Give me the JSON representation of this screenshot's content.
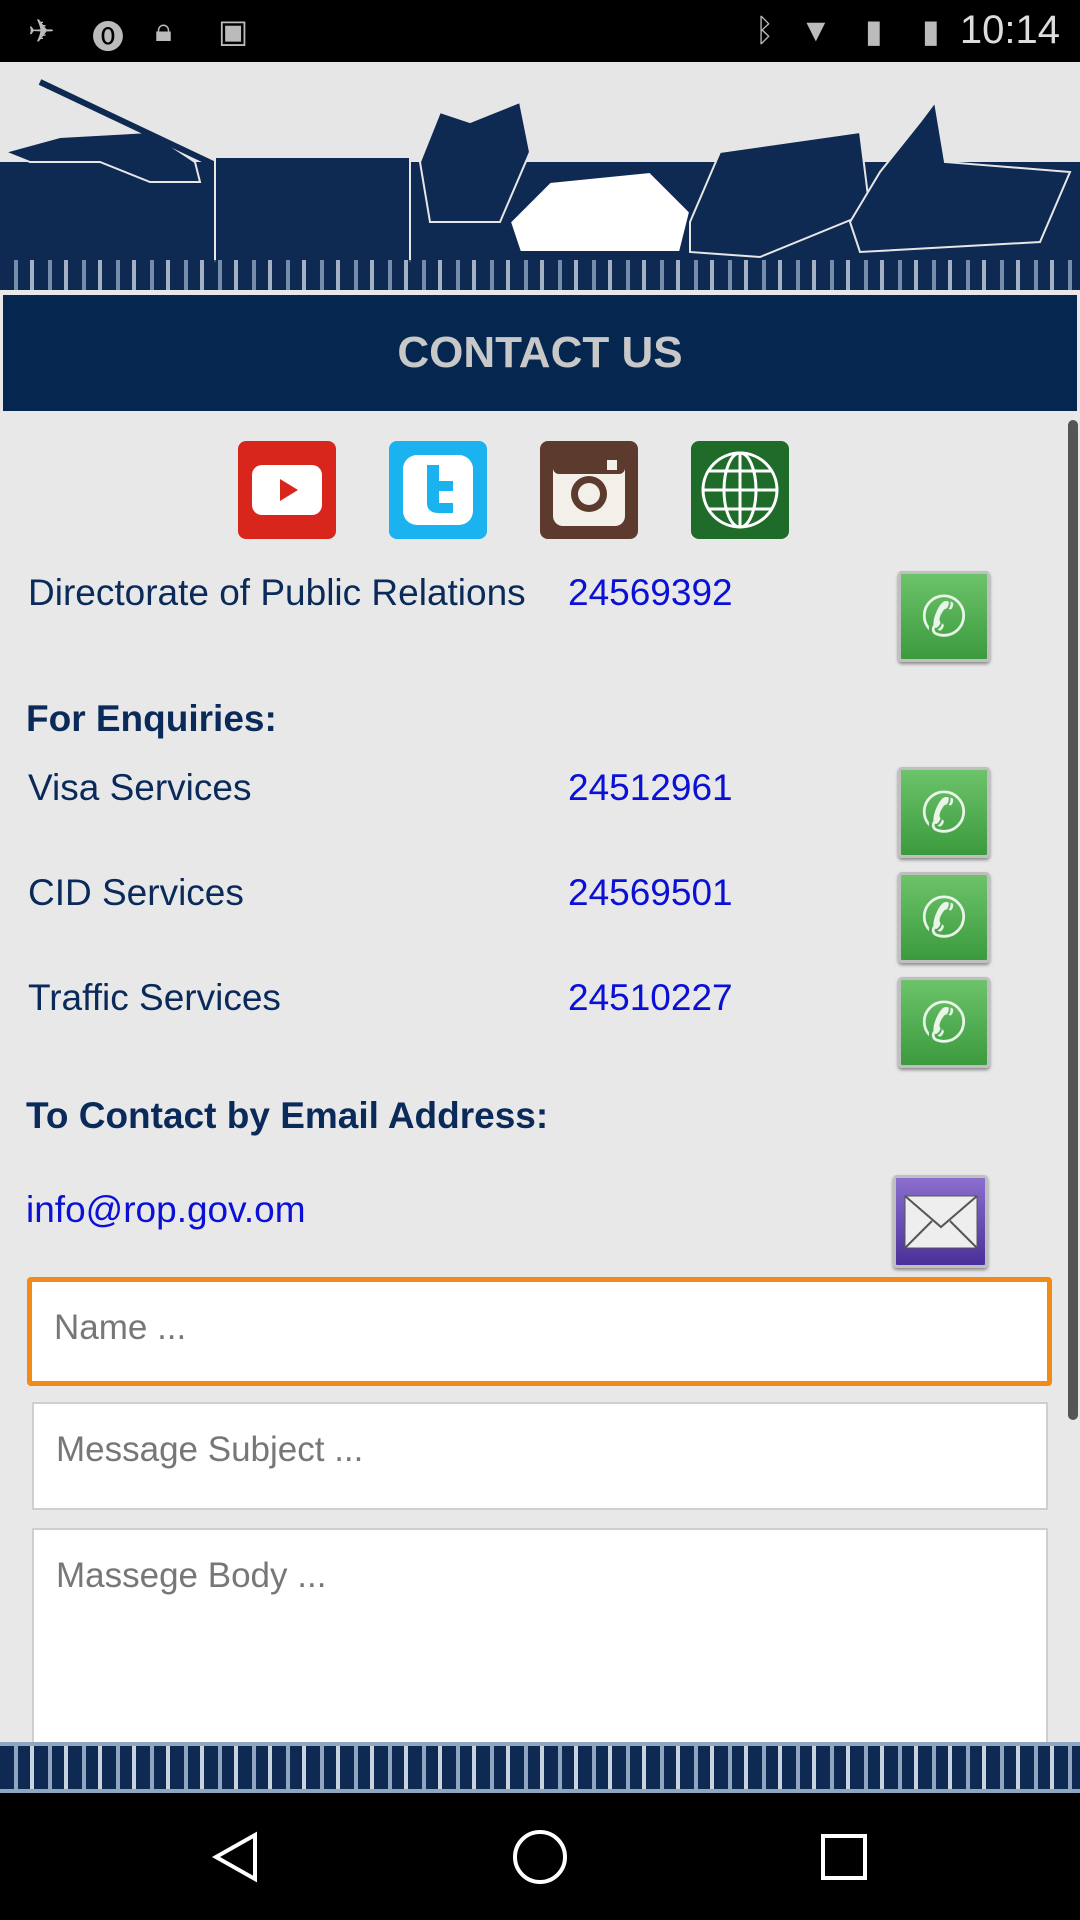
{
  "status_bar": {
    "time": "10:14",
    "icons": [
      "fake-gps-icon",
      "alarm-icon",
      "lock-icon",
      "android-icon",
      "bluetooth-icon",
      "wifi-icon",
      "no-sim-icon",
      "battery-charging-icon"
    ]
  },
  "header": {
    "title": "CONTACT US"
  },
  "social": [
    {
      "name": "youtube",
      "color": "#d9261c"
    },
    {
      "name": "twitter",
      "color": "#1ab2ef"
    },
    {
      "name": "instagram",
      "color": "#5c3a2e"
    },
    {
      "name": "website",
      "color": "#1e6b2a"
    }
  ],
  "directorate": {
    "label": "Directorate of Public Relations",
    "number": "24569392"
  },
  "enquiries": {
    "title": "For Enquiries:",
    "items": [
      {
        "label": "Visa Services",
        "number": "24512961"
      },
      {
        "label": "CID Services",
        "number": "24569501"
      },
      {
        "label": "Traffic Services",
        "number": "24510227"
      }
    ]
  },
  "email": {
    "title": "To Contact by Email Address:",
    "address": "info@rop.gov.om"
  },
  "form": {
    "name_placeholder": "Name ...",
    "subject_placeholder": "Message Subject ...",
    "body_placeholder": "Massege Body ..."
  },
  "colors": {
    "navy": "#04264f",
    "number_blue": "#0b10d6",
    "focus": "#f28a1a",
    "call_green": "#4caf50"
  }
}
